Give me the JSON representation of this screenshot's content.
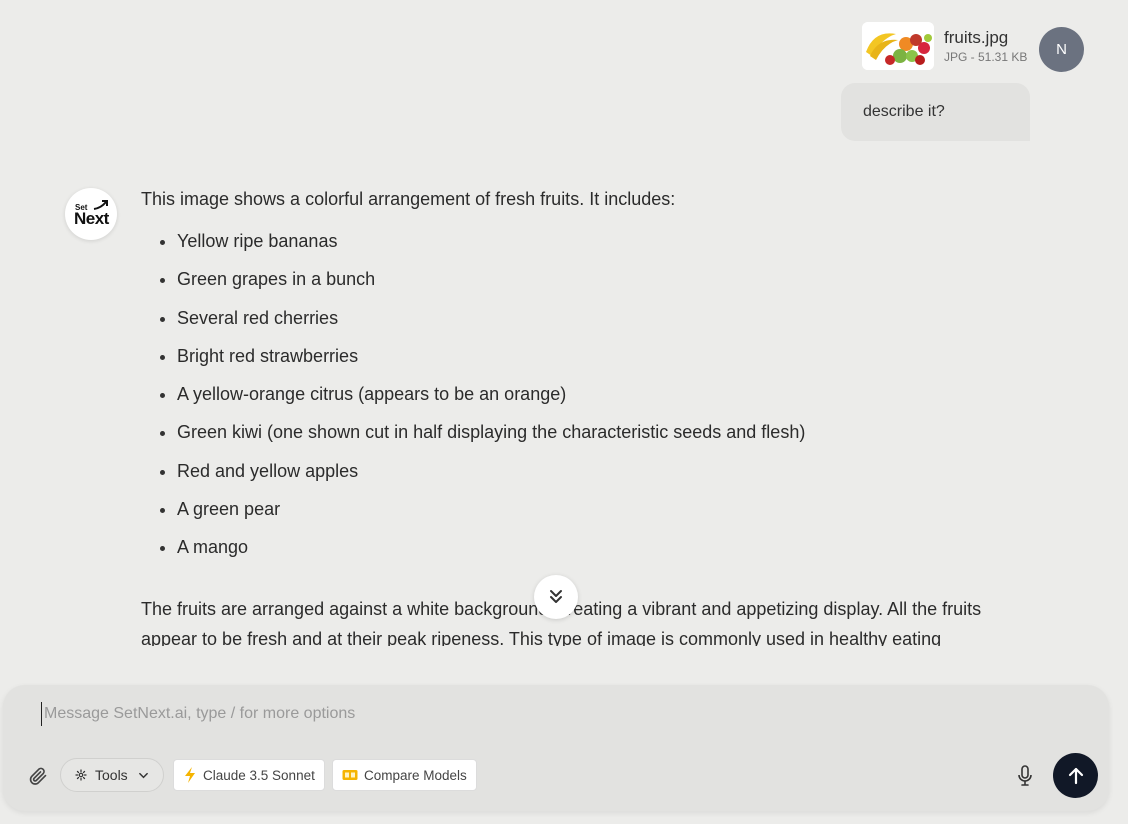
{
  "user_message": {
    "attachment": {
      "file_name": "fruits.jpg",
      "file_info": "JPG - 51.31 KB"
    },
    "avatar_initial": "N",
    "text": "describe it?"
  },
  "assistant_message": {
    "intro": "This image shows a colorful arrangement of fresh fruits. It includes:",
    "items": [
      "Yellow ripe bananas",
      "Green grapes in a bunch",
      "Several red cherries",
      "Bright red strawberries",
      "A yellow-orange citrus (appears to be an orange)",
      "Green kiwi (one shown cut in half displaying the characteristic seeds and flesh)",
      "Red and yellow apples",
      "A green pear",
      "A mango"
    ],
    "outro": "The fruits are arranged against a white background, creating a vibrant and appetizing display. All the fruits appear to be fresh and at their peak ripeness. This type of image is commonly used in healthy eating",
    "logo_small": "Set",
    "logo_main": "Next"
  },
  "composer": {
    "placeholder": "Message SetNext.ai, type / for more options",
    "tools_label": "Tools",
    "model_label": "Claude 3.5 Sonnet",
    "compare_label": "Compare Models"
  },
  "icons": {
    "attach": "paperclip-icon",
    "tools": "gear-icon",
    "model": "lightning-icon",
    "compare": "compare-icon",
    "mic": "microphone-icon",
    "send": "arrow-up-icon",
    "scroll": "double-chevron-down-icon"
  },
  "colors": {
    "background": "#ececea",
    "send_button": "#111827",
    "user_avatar": "#6b7280",
    "lightning": "#f5b400"
  }
}
